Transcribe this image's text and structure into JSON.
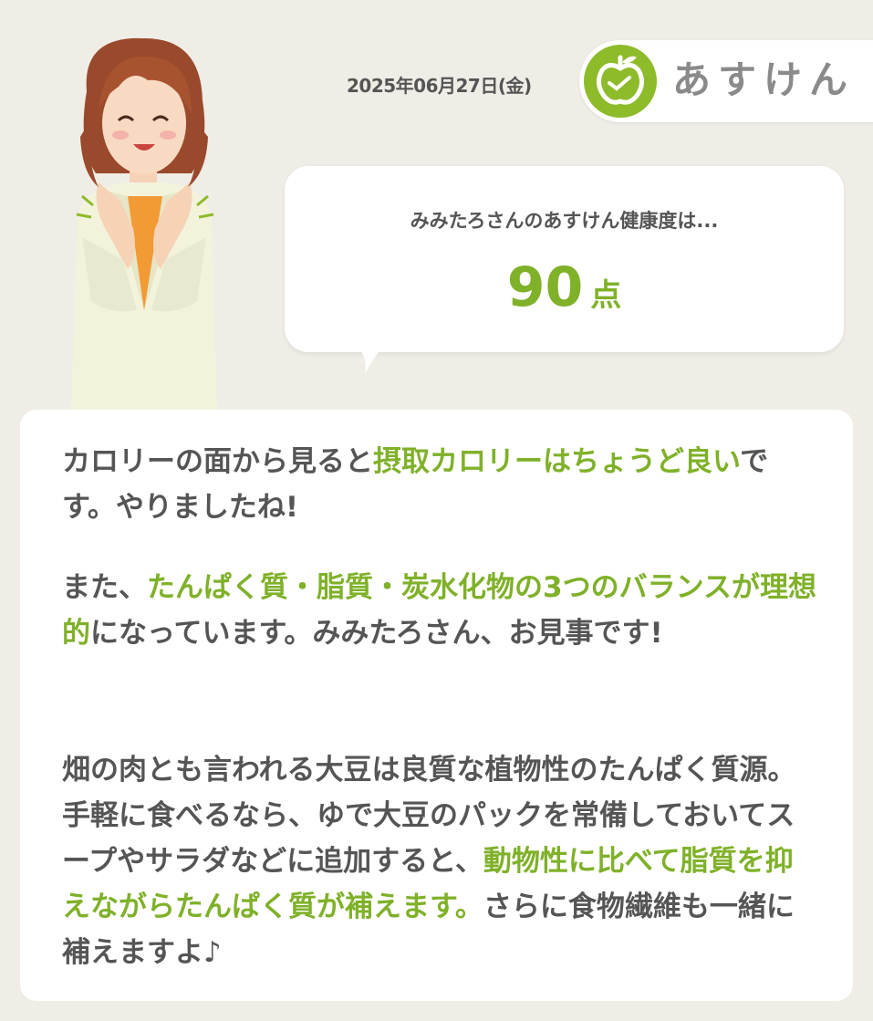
{
  "header": {
    "date": "2025年06月27日(金)",
    "app_name": "あすけん",
    "logo_icon": "apple-logo-icon"
  },
  "score_bubble": {
    "label": "みみたろさんのあすけん健康度は...",
    "score": "90",
    "unit": "点"
  },
  "message": {
    "p1": {
      "pre": "カロリーの面から見ると",
      "highlight": "摂取カロリーはちょうど良い",
      "post": "です。やりましたね!"
    },
    "p2": {
      "pre": "また、",
      "highlight": "たんぱく質・脂質・炭水化物の3つのバランスが理想的",
      "post": "になっています。みみたろさん、お見事です!"
    },
    "p3": {
      "pre": "畑の肉とも言われる大豆は良質な植物性のたんぱく質源。手軽に食べるなら、ゆで大豆のパックを常備しておいてスープやサラダなどに追加すると、",
      "highlight": "動物性に比べて脂質を抑えながらたんぱく質が補えます。",
      "post": "さらに食物繊維も一緒に補えますよ♪"
    }
  },
  "colors": {
    "accent_green": "#7fb129",
    "logo_green": "#8dbb2a",
    "background": "#efede6",
    "text": "#555555"
  }
}
